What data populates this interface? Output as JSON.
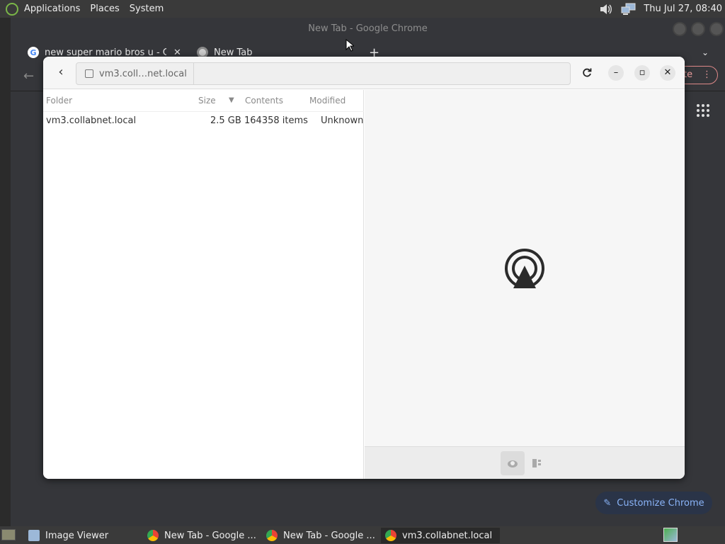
{
  "top_panel": {
    "menus": [
      "Applications",
      "Places",
      "System"
    ],
    "clock": "Thu Jul 27, 08:40"
  },
  "chrome": {
    "title": "New Tab - Google Chrome",
    "tabs": [
      {
        "label": "new super mario bros u - Goo"
      },
      {
        "label": "New Tab"
      }
    ],
    "update_label": "ate",
    "customize_label": "Customize Chrome"
  },
  "dialog": {
    "path_segment": "vm3.coll…net.local",
    "columns": {
      "folder": "Folder",
      "size": "Size",
      "contents": "Contents",
      "modified": "Modified"
    },
    "rows": [
      {
        "folder": "vm3.collabnet.local",
        "size": "2.5 GB",
        "contents": "164358 items",
        "modified": "Unknown"
      }
    ]
  },
  "taskbar": {
    "items": [
      {
        "label": "Image Viewer"
      },
      {
        "label": "New Tab - Google ..."
      },
      {
        "label": "New Tab - Google ..."
      },
      {
        "label": "vm3.collabnet.local"
      }
    ]
  },
  "colors": {
    "accent_blue": "#8ab4f8",
    "panel_bg": "#3a3a3a",
    "chrome_bg": "#35363a"
  }
}
